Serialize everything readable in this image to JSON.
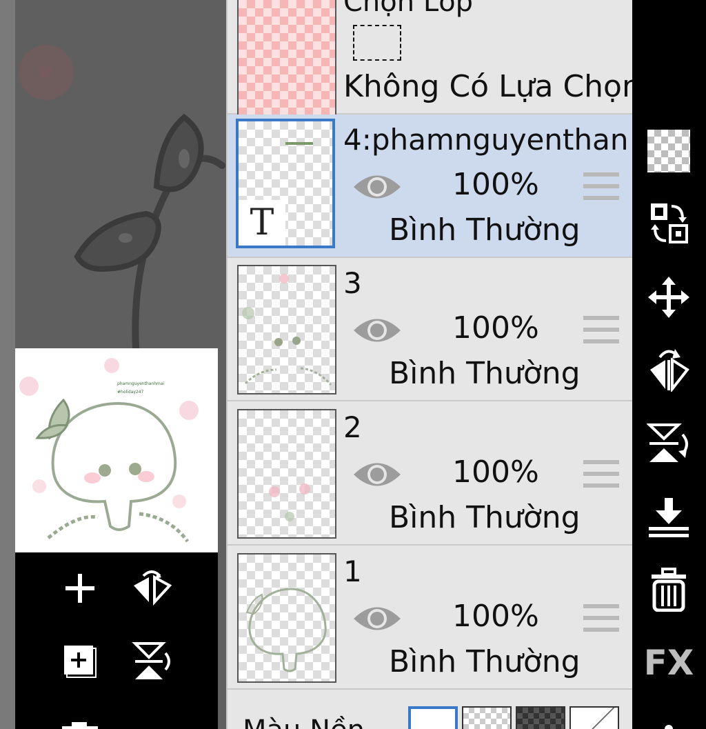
{
  "selection_layer": {
    "title": "Chọn Lớp",
    "status": "Không Có Lựa Chọn"
  },
  "layers": [
    {
      "name": "4:phamnguyenthan",
      "opacity": "100%",
      "blend": "Bình Thường",
      "selected": true,
      "thumb_badge": "T"
    },
    {
      "name": "3",
      "opacity": "100%",
      "blend": "Bình Thường",
      "selected": false
    },
    {
      "name": "2",
      "opacity": "100%",
      "blend": "Bình Thường",
      "selected": false
    },
    {
      "name": "1",
      "opacity": "100%",
      "blend": "Bình Thường",
      "selected": false
    }
  ],
  "background_row": {
    "label": "Màu Nền"
  },
  "preview": {
    "line1": "phamnguyenthanhmai",
    "line2": "#holiday247"
  },
  "right_toolbar": {
    "fx_label": "FX",
    "icons": [
      "transparency-icon",
      "swap-layers-icon",
      "move-icon",
      "flip-horizontal-icon",
      "flip-vertical-icon",
      "merge-down-icon",
      "trash-icon",
      "fx-icon",
      "more-icon"
    ]
  },
  "left_toolbar": {
    "icons": [
      "add-layer-icon",
      "flip-horizontal-icon",
      "duplicate-layer-icon",
      "flip-vertical-icon",
      "camera-icon"
    ]
  },
  "colors": {
    "panel_bg": "#e6e6e6",
    "selected_row": "#cdd9ec",
    "selected_border": "#3a78c8",
    "toolbar_bg": "#000000",
    "canvas_bg": "#5f5f5f"
  }
}
